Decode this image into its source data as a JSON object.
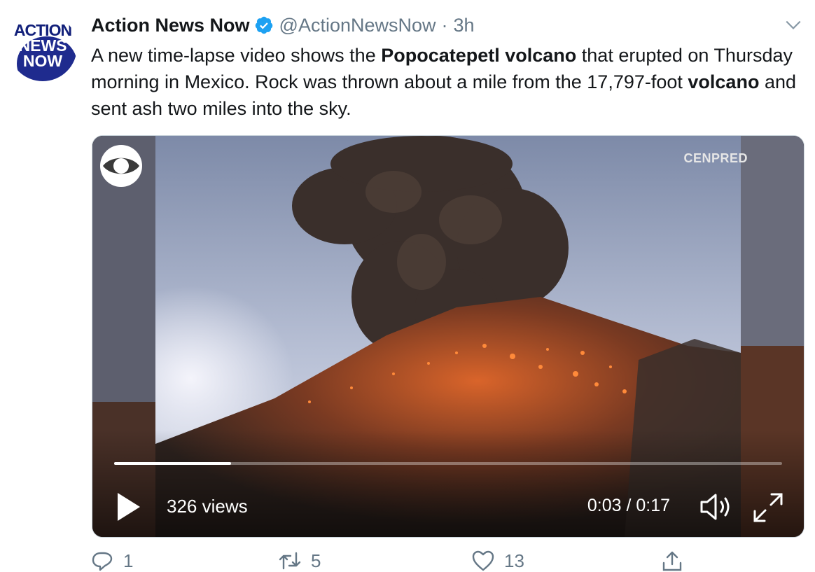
{
  "account": {
    "logo_lines": [
      "ACTION",
      "NEWS",
      "NOW"
    ],
    "name": "Action News Now",
    "handle": "@ActionNewsNow",
    "separator": "·",
    "time": "3h",
    "verified_color": "#1da1f2"
  },
  "tweet": {
    "parts": [
      {
        "text": "A new time-lapse video shows the ",
        "bold": false
      },
      {
        "text": "Popocatepetl volcano",
        "bold": true
      },
      {
        "text": " that erupted on Thursday morning in Mexico. Rock was thrown about a mile from the 17,797-foot ",
        "bold": false
      },
      {
        "text": "volcano",
        "bold": true
      },
      {
        "text": " and sent ash two miles into the sky.",
        "bold": false
      }
    ]
  },
  "media": {
    "credit": "CENPRED",
    "views": "326 views",
    "timecode": "0:03 / 0:17",
    "progress": 0.175,
    "icons": [
      "cbs-eye-logo",
      "play-icon",
      "volume-icon",
      "fullscreen-icon"
    ]
  },
  "actions": {
    "reply_count": "1",
    "retweet_count": "5",
    "like_count": "13",
    "icons": [
      "reply-icon",
      "retweet-icon",
      "like-icon",
      "share-icon"
    ]
  },
  "colors": {
    "text": "#14171a",
    "secondary": "#657786",
    "brand_navy": "#1f2b8e"
  }
}
